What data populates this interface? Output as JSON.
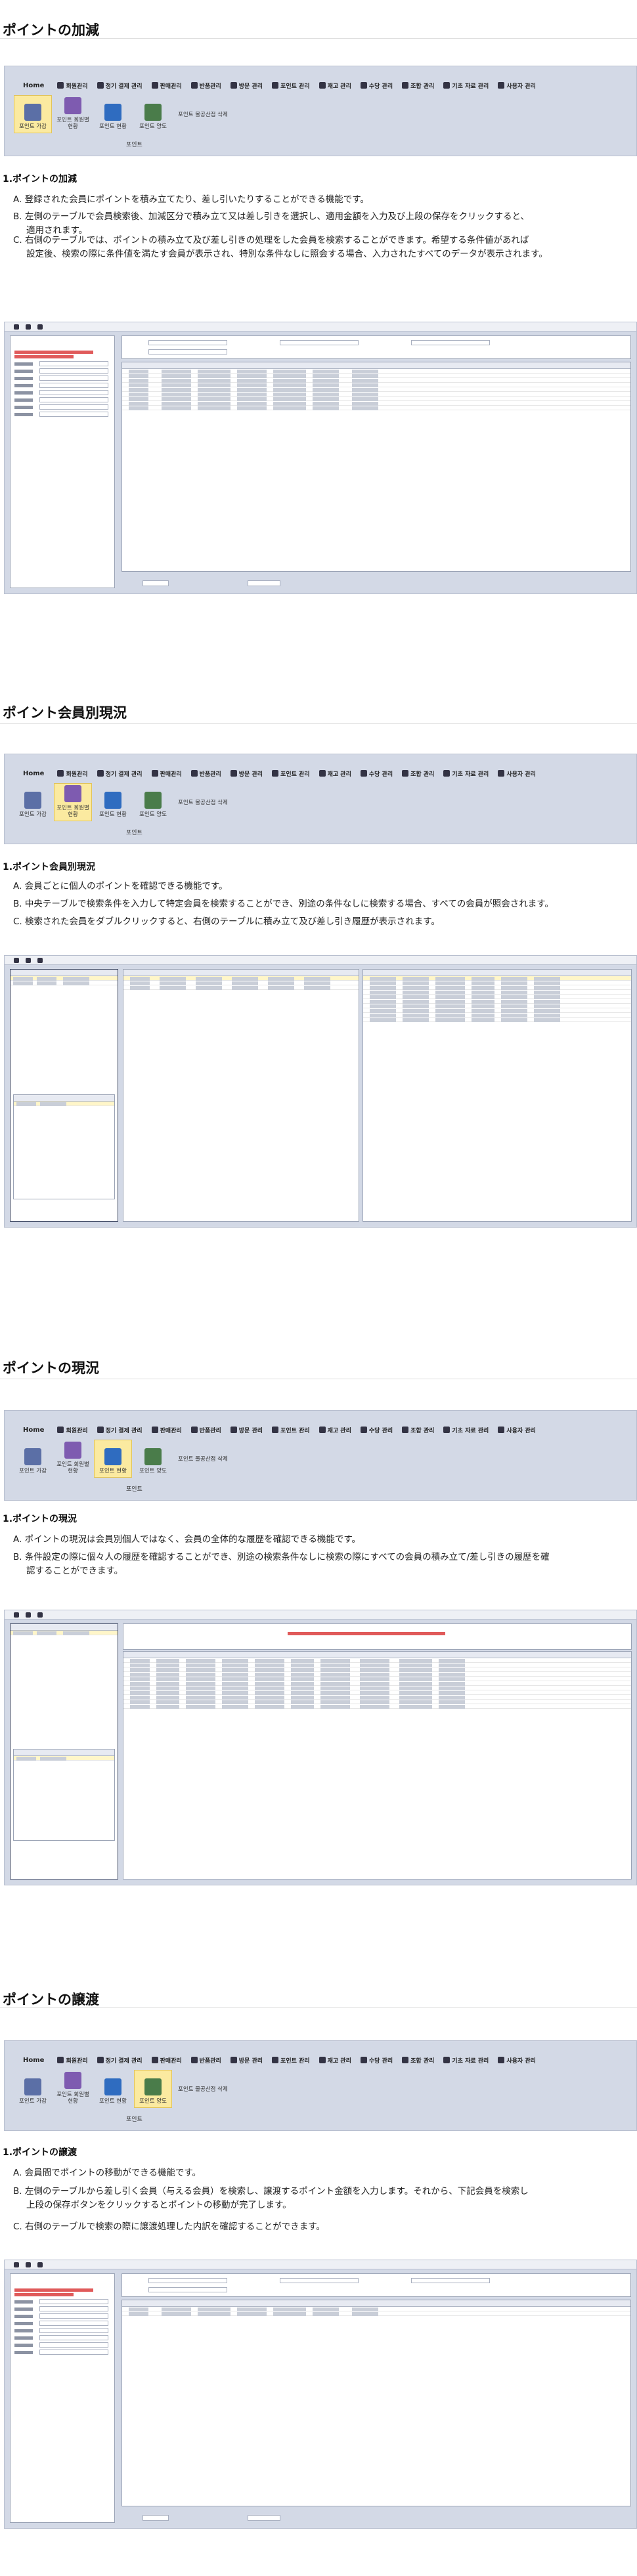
{
  "menu": {
    "home": "Home",
    "items": [
      "회원관리",
      "정기 결제 관리",
      "판매관리",
      "반품관리",
      "방문 관리",
      "포인트 관리",
      "재고 관리",
      "수당 관리",
      "조합 관리",
      "기초 자료 관리",
      "사용자 관리"
    ],
    "ribbon": [
      "포인트 가감",
      "포인트 회원별 현황",
      "포인트 현황",
      "포인트 양도"
    ],
    "ribbon_extra": "포인트 몰공산점 삭제",
    "group": "포인트"
  },
  "sections": [
    {
      "title": "ポイントの加減",
      "subtitle": "1.ポイントの加減",
      "active": 0,
      "items": [
        {
          "mark": "A.",
          "text": "登録された会員にポイントを積み立てたり、差し引いたりすることができる機能です。"
        },
        {
          "mark": "B.",
          "text": "左側のテーブルで会員検索後、加減区分で積み立て又は差し引きを選択し、適用金額を入力及び上段の保存をクリックすると、",
          "cont": "適用されます。"
        },
        {
          "mark": "C.",
          "text": "右側のテーブルでは、ポイントの積み立て及び差し引きの処理をした会員を検索することができます。希望する条件値があれば",
          "cont": "設定後、検索の際に条件値を満たす会員が表示され、特別な条件なしに照会する場合、入力されたすべてのデータが表示されます。"
        }
      ]
    },
    {
      "title": "ポイント会員別現況",
      "subtitle": "1.ポイント会員別現況",
      "active": 1,
      "items": [
        {
          "mark": "A.",
          "text": "会員ごとに個人のポイントを確認できる機能です。"
        },
        {
          "mark": "B.",
          "text": "中央テーブルで検索条件を入力して特定会員を検索することができ、別途の条件なしに検索する場合、すべての会員が照会されます。"
        },
        {
          "mark": "C.",
          "text": "検索された会員をダブルクリックすると、右側のテーブルに積み立て及び差し引き履歴が表示されます。"
        }
      ]
    },
    {
      "title": "ポイントの現況",
      "subtitle": "1.ポイントの現況",
      "active": 2,
      "items": [
        {
          "mark": "A.",
          "text": "ポイントの現況は会員別個人ではなく、会員の全体的な履歴を確認できる機能です。"
        },
        {
          "mark": "B.",
          "text": "条件設定の際に個々人の履歴を確認することができ、別途の検索条件なしに検索の際にすべての会員の積み立て/差し引きの履歴を確",
          "cont": "認することができます。"
        }
      ]
    },
    {
      "title": "ポイントの譲渡",
      "subtitle": "1.ポイントの譲渡",
      "active": 3,
      "items": [
        {
          "mark": "A.",
          "text": "会員間でポイントの移動ができる機能です。"
        },
        {
          "mark": "B.",
          "text": "左側のテーブルから差し引く会員（与える会員）を検索し、譲渡するポイント金額を入力します。それから、下記会員を検索し",
          "cont": "上段の保存ボタンをクリックするとポイントの移動が完了します。"
        },
        {
          "mark": "C.",
          "text": "右側のテーブルで検索の際に譲渡処理した内訳を確認することができます。"
        }
      ]
    }
  ]
}
